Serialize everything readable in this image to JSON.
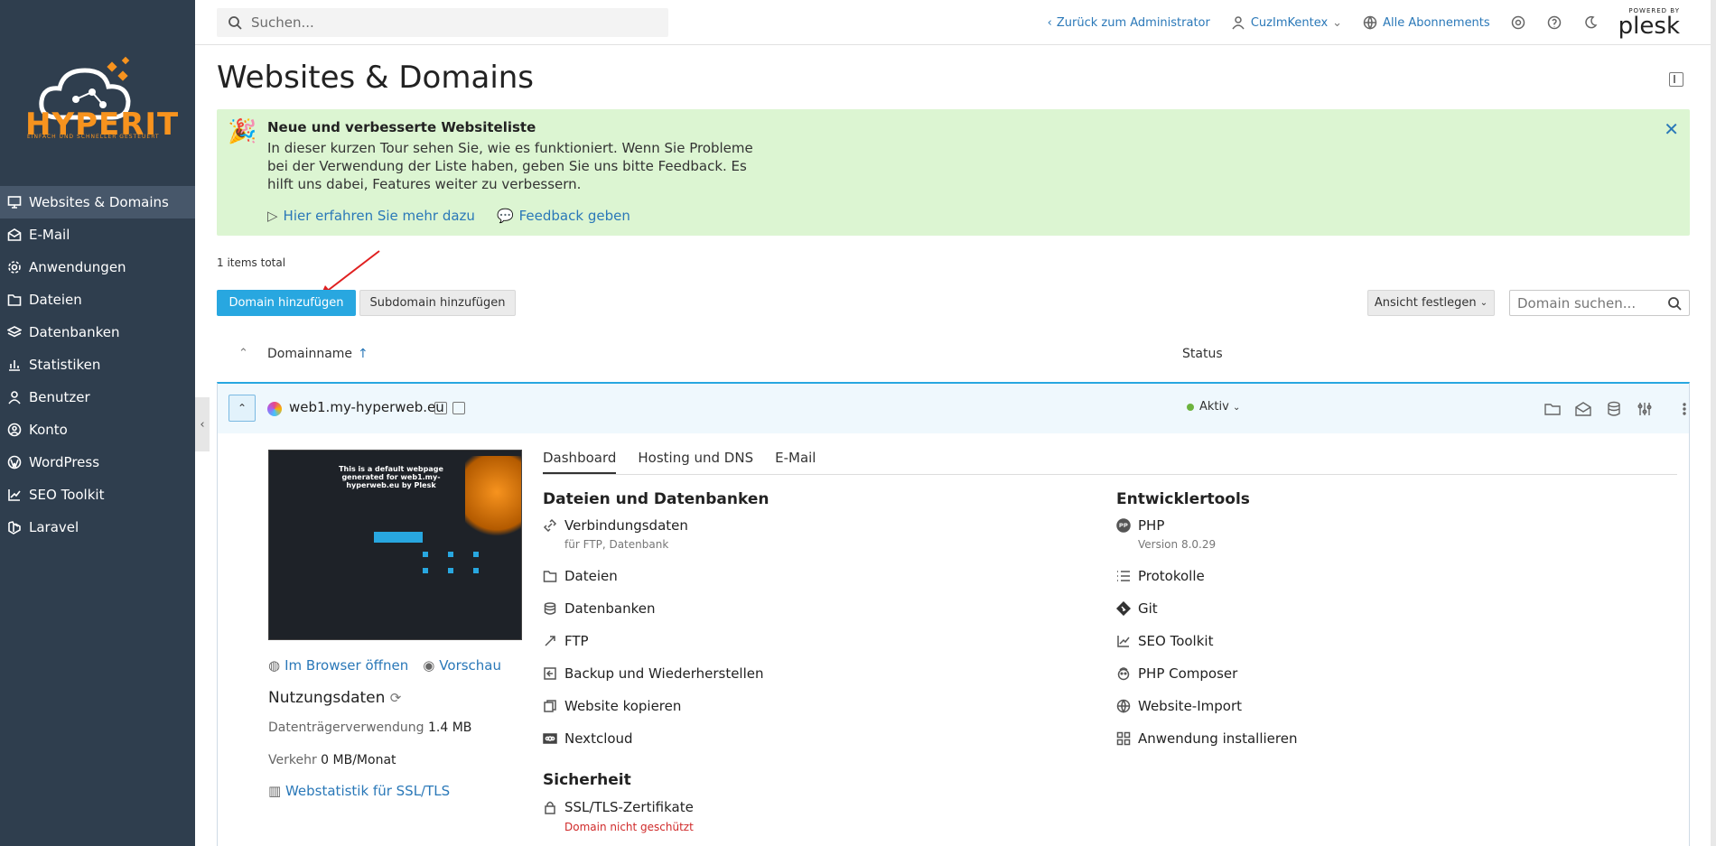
{
  "sidebar": {
    "logo_text": "HYPERIT",
    "logo_tagline": "EINFACH UND SCHNELLER GESTEUERT",
    "items": [
      {
        "label": "Websites & Domains",
        "icon": "monitor-icon"
      },
      {
        "label": "E-Mail",
        "icon": "mail-icon"
      },
      {
        "label": "Anwendungen",
        "icon": "gear-icon"
      },
      {
        "label": "Dateien",
        "icon": "folder-icon"
      },
      {
        "label": "Datenbanken",
        "icon": "layers-icon"
      },
      {
        "label": "Statistiken",
        "icon": "bar-chart-icon"
      },
      {
        "label": "Benutzer",
        "icon": "user-icon"
      },
      {
        "label": "Konto",
        "icon": "account-icon"
      },
      {
        "label": "WordPress",
        "icon": "wordpress-icon"
      },
      {
        "label": "SEO Toolkit",
        "icon": "seo-icon"
      },
      {
        "label": "Laravel",
        "icon": "laravel-icon"
      }
    ]
  },
  "topbar": {
    "search_placeholder": "Suchen...",
    "back_link": "Zurück zum Administrator",
    "user": "CuzImKentex",
    "subscriptions": "Alle Abonnements",
    "brand_small": "POWERED BY",
    "brand": "plesk"
  },
  "page": {
    "title": "Websites & Domains"
  },
  "banner": {
    "title": "Neue und verbesserte Websiteliste",
    "body": "In dieser kurzen Tour sehen Sie, wie es funktioniert. Wenn Sie Probleme bei der Verwendung der Liste haben, geben Sie uns bitte Feedback. Es hilft uns dabei, Features weiter zu verbessern.",
    "link_more": "Hier erfahren Sie mehr dazu",
    "link_feedback": "Feedback geben"
  },
  "list": {
    "items_total": "1 items total",
    "add_domain": "Domain hinzufügen",
    "add_subdomain": "Subdomain hinzufügen",
    "view": "Ansicht festlegen",
    "search_placeholder": "Domain suchen...",
    "col_domain": "Domainname",
    "col_status": "Status"
  },
  "domain": {
    "name": "web1.my-hyperweb.eu",
    "status": "Aktiv",
    "preview_text": "This is a default webpage generated for web1.my-hyperweb.eu by Plesk",
    "open_browser": "Im Browser öffnen",
    "preview": "Vorschau",
    "usage_title": "Nutzungsdaten",
    "disk_label": "Datenträgerverwendung",
    "disk_value": "1.4 MB",
    "traffic_label": "Verkehr",
    "traffic_value": "0 MB/Monat",
    "webstat": "Webstatistik für SSL/TLS"
  },
  "tabs": [
    "Dashboard",
    "Hosting und DNS",
    "E-Mail"
  ],
  "sections": {
    "files_db": "Dateien und Datenbanken",
    "devtools": "Entwicklertools",
    "security": "Sicherheit"
  },
  "tools_left": {
    "connection": "Verbindungsdaten",
    "connection_sub": "für FTP, Datenbank",
    "files": "Dateien",
    "databases": "Datenbanken",
    "ftp": "FTP",
    "backup": "Backup und Wiederherstellen",
    "copy": "Website kopieren",
    "nextcloud": "Nextcloud",
    "ssl": "SSL/TLS-Zertifikate",
    "ssl_warn": "Domain nicht geschützt"
  },
  "tools_right": {
    "php": "PHP",
    "php_version": "Version 8.0.29",
    "logs": "Protokolle",
    "git": "Git",
    "seo": "SEO Toolkit",
    "composer": "PHP Composer",
    "import": "Website-Import",
    "install": "Anwendung installieren"
  },
  "colors": {
    "sidebar": "#2f3e4e",
    "accent": "#28a7e0",
    "link": "#2a78b8",
    "banner": "#dcf5d2",
    "brand_orange": "#f7931e"
  }
}
